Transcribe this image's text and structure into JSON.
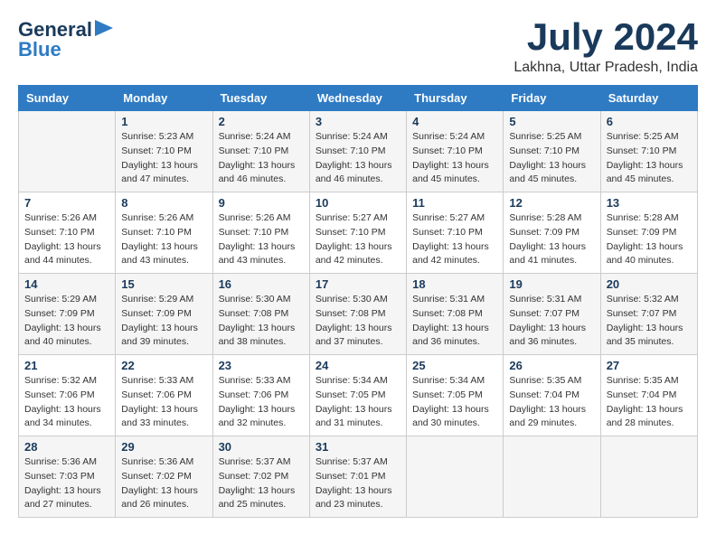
{
  "header": {
    "logo_line1": "General",
    "logo_line2": "Blue",
    "month": "July 2024",
    "location": "Lakhna, Uttar Pradesh, India"
  },
  "days_of_week": [
    "Sunday",
    "Monday",
    "Tuesday",
    "Wednesday",
    "Thursday",
    "Friday",
    "Saturday"
  ],
  "weeks": [
    [
      {
        "num": "",
        "info": ""
      },
      {
        "num": "1",
        "info": "Sunrise: 5:23 AM\nSunset: 7:10 PM\nDaylight: 13 hours\nand 47 minutes."
      },
      {
        "num": "2",
        "info": "Sunrise: 5:24 AM\nSunset: 7:10 PM\nDaylight: 13 hours\nand 46 minutes."
      },
      {
        "num": "3",
        "info": "Sunrise: 5:24 AM\nSunset: 7:10 PM\nDaylight: 13 hours\nand 46 minutes."
      },
      {
        "num": "4",
        "info": "Sunrise: 5:24 AM\nSunset: 7:10 PM\nDaylight: 13 hours\nand 45 minutes."
      },
      {
        "num": "5",
        "info": "Sunrise: 5:25 AM\nSunset: 7:10 PM\nDaylight: 13 hours\nand 45 minutes."
      },
      {
        "num": "6",
        "info": "Sunrise: 5:25 AM\nSunset: 7:10 PM\nDaylight: 13 hours\nand 45 minutes."
      }
    ],
    [
      {
        "num": "7",
        "info": "Sunrise: 5:26 AM\nSunset: 7:10 PM\nDaylight: 13 hours\nand 44 minutes."
      },
      {
        "num": "8",
        "info": "Sunrise: 5:26 AM\nSunset: 7:10 PM\nDaylight: 13 hours\nand 43 minutes."
      },
      {
        "num": "9",
        "info": "Sunrise: 5:26 AM\nSunset: 7:10 PM\nDaylight: 13 hours\nand 43 minutes."
      },
      {
        "num": "10",
        "info": "Sunrise: 5:27 AM\nSunset: 7:10 PM\nDaylight: 13 hours\nand 42 minutes."
      },
      {
        "num": "11",
        "info": "Sunrise: 5:27 AM\nSunset: 7:10 PM\nDaylight: 13 hours\nand 42 minutes."
      },
      {
        "num": "12",
        "info": "Sunrise: 5:28 AM\nSunset: 7:09 PM\nDaylight: 13 hours\nand 41 minutes."
      },
      {
        "num": "13",
        "info": "Sunrise: 5:28 AM\nSunset: 7:09 PM\nDaylight: 13 hours\nand 40 minutes."
      }
    ],
    [
      {
        "num": "14",
        "info": "Sunrise: 5:29 AM\nSunset: 7:09 PM\nDaylight: 13 hours\nand 40 minutes."
      },
      {
        "num": "15",
        "info": "Sunrise: 5:29 AM\nSunset: 7:09 PM\nDaylight: 13 hours\nand 39 minutes."
      },
      {
        "num": "16",
        "info": "Sunrise: 5:30 AM\nSunset: 7:08 PM\nDaylight: 13 hours\nand 38 minutes."
      },
      {
        "num": "17",
        "info": "Sunrise: 5:30 AM\nSunset: 7:08 PM\nDaylight: 13 hours\nand 37 minutes."
      },
      {
        "num": "18",
        "info": "Sunrise: 5:31 AM\nSunset: 7:08 PM\nDaylight: 13 hours\nand 36 minutes."
      },
      {
        "num": "19",
        "info": "Sunrise: 5:31 AM\nSunset: 7:07 PM\nDaylight: 13 hours\nand 36 minutes."
      },
      {
        "num": "20",
        "info": "Sunrise: 5:32 AM\nSunset: 7:07 PM\nDaylight: 13 hours\nand 35 minutes."
      }
    ],
    [
      {
        "num": "21",
        "info": "Sunrise: 5:32 AM\nSunset: 7:06 PM\nDaylight: 13 hours\nand 34 minutes."
      },
      {
        "num": "22",
        "info": "Sunrise: 5:33 AM\nSunset: 7:06 PM\nDaylight: 13 hours\nand 33 minutes."
      },
      {
        "num": "23",
        "info": "Sunrise: 5:33 AM\nSunset: 7:06 PM\nDaylight: 13 hours\nand 32 minutes."
      },
      {
        "num": "24",
        "info": "Sunrise: 5:34 AM\nSunset: 7:05 PM\nDaylight: 13 hours\nand 31 minutes."
      },
      {
        "num": "25",
        "info": "Sunrise: 5:34 AM\nSunset: 7:05 PM\nDaylight: 13 hours\nand 30 minutes."
      },
      {
        "num": "26",
        "info": "Sunrise: 5:35 AM\nSunset: 7:04 PM\nDaylight: 13 hours\nand 29 minutes."
      },
      {
        "num": "27",
        "info": "Sunrise: 5:35 AM\nSunset: 7:04 PM\nDaylight: 13 hours\nand 28 minutes."
      }
    ],
    [
      {
        "num": "28",
        "info": "Sunrise: 5:36 AM\nSunset: 7:03 PM\nDaylight: 13 hours\nand 27 minutes."
      },
      {
        "num": "29",
        "info": "Sunrise: 5:36 AM\nSunset: 7:02 PM\nDaylight: 13 hours\nand 26 minutes."
      },
      {
        "num": "30",
        "info": "Sunrise: 5:37 AM\nSunset: 7:02 PM\nDaylight: 13 hours\nand 25 minutes."
      },
      {
        "num": "31",
        "info": "Sunrise: 5:37 AM\nSunset: 7:01 PM\nDaylight: 13 hours\nand 23 minutes."
      },
      {
        "num": "",
        "info": ""
      },
      {
        "num": "",
        "info": ""
      },
      {
        "num": "",
        "info": ""
      }
    ]
  ]
}
